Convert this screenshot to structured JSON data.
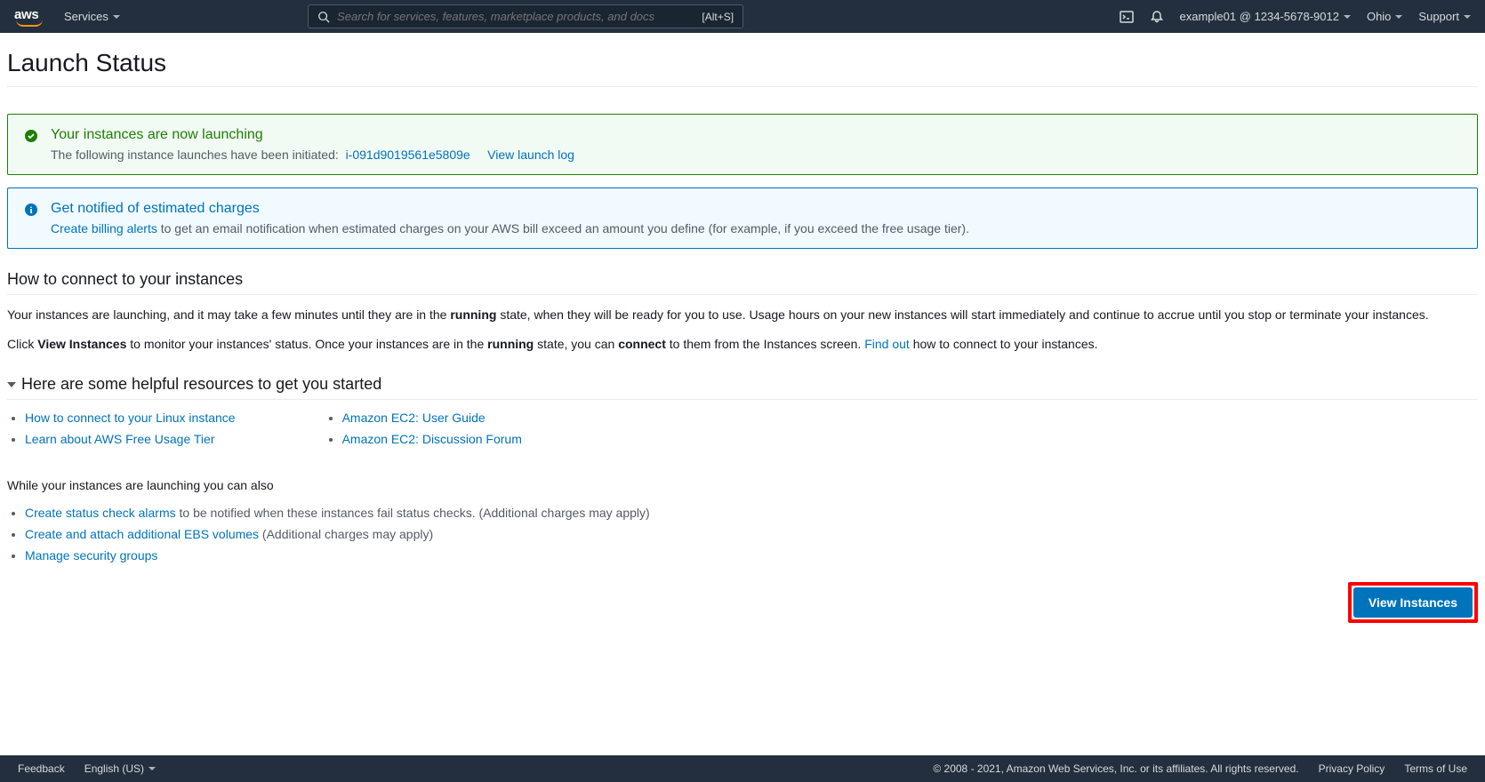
{
  "topbar": {
    "services": "Services",
    "search_placeholder": "Search for services, features, marketplace products, and docs",
    "shortcut": "[Alt+S]",
    "account": "example01 @ 1234-5678-9012",
    "region": "Ohio",
    "support": "Support"
  },
  "page": {
    "title": "Launch Status"
  },
  "success": {
    "title": "Your instances are now launching",
    "body": "The following instance launches have been initiated:",
    "instance_id": "i-091d9019561e5809e",
    "view_log": "View launch log"
  },
  "notify": {
    "title": "Get notified of estimated charges",
    "link": "Create billing alerts",
    "body": "to get an email notification when estimated charges on your AWS bill exceed an amount you define (for example, if you exceed the free usage tier)."
  },
  "connect": {
    "heading": "How to connect to your instances",
    "p1a": "Your instances are launching, and it may take a few minutes until they are in the ",
    "p1b": "running",
    "p1c": " state, when they will be ready for you to use. Usage hours on your new instances will start immediately and continue to accrue until you stop or terminate your instances.",
    "p2a": "Click ",
    "p2b": "View Instances",
    "p2c": " to monitor your instances' status. Once your instances are in the ",
    "p2d": "running",
    "p2e": " state, you can ",
    "p2f": "connect",
    "p2g": " to them from the Instances screen. ",
    "find_out": "Find out",
    "p2h": " how to connect to your instances."
  },
  "resources": {
    "heading": "Here are some helpful resources to get you started",
    "col1": {
      "l1": "How to connect to your Linux instance",
      "l2": "Learn about AWS Free Usage Tier"
    },
    "col2": {
      "l1": "Amazon EC2: User Guide",
      "l2": "Amazon EC2: Discussion Forum"
    }
  },
  "while": {
    "intro": "While your instances are launching you can also",
    "l1": "Create status check alarms",
    "l1_after": " to be notified when these instances fail status checks. (Additional charges may apply)",
    "l2": "Create and attach additional EBS volumes",
    "l2_after": " (Additional charges may apply)",
    "l3": "Manage security groups"
  },
  "button": "View Instances",
  "footer": {
    "feedback": "Feedback",
    "language": "English (US)",
    "copyright": "© 2008 - 2021, Amazon Web Services, Inc. or its affiliates. All rights reserved.",
    "privacy": "Privacy Policy",
    "terms": "Terms of Use"
  }
}
